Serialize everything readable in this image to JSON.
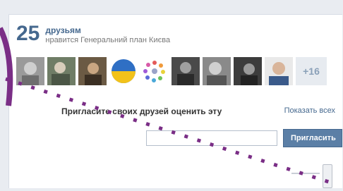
{
  "widget": {
    "count": "25",
    "count_label": "друзьям",
    "likes_text": "нравится Генеральний план Києва",
    "more_badge": "+16",
    "invite_text": "Пригласите своих друзей оценить эту",
    "show_all": "Показать всех",
    "friend_input_value": "",
    "invite_button": "Пригласить"
  },
  "colors": {
    "link": "#45688e",
    "button": "#5b7fa6",
    "annotation_line": "#7a2e86"
  },
  "avatars": [
    {
      "name": "friend-avatar-1"
    },
    {
      "name": "friend-avatar-2"
    },
    {
      "name": "friend-avatar-3"
    },
    {
      "name": "ukraine-flag-avatar"
    },
    {
      "name": "circle-logo-avatar"
    },
    {
      "name": "friend-avatar-6"
    },
    {
      "name": "friend-avatar-7"
    },
    {
      "name": "friend-avatar-8"
    },
    {
      "name": "friend-avatar-9"
    }
  ]
}
